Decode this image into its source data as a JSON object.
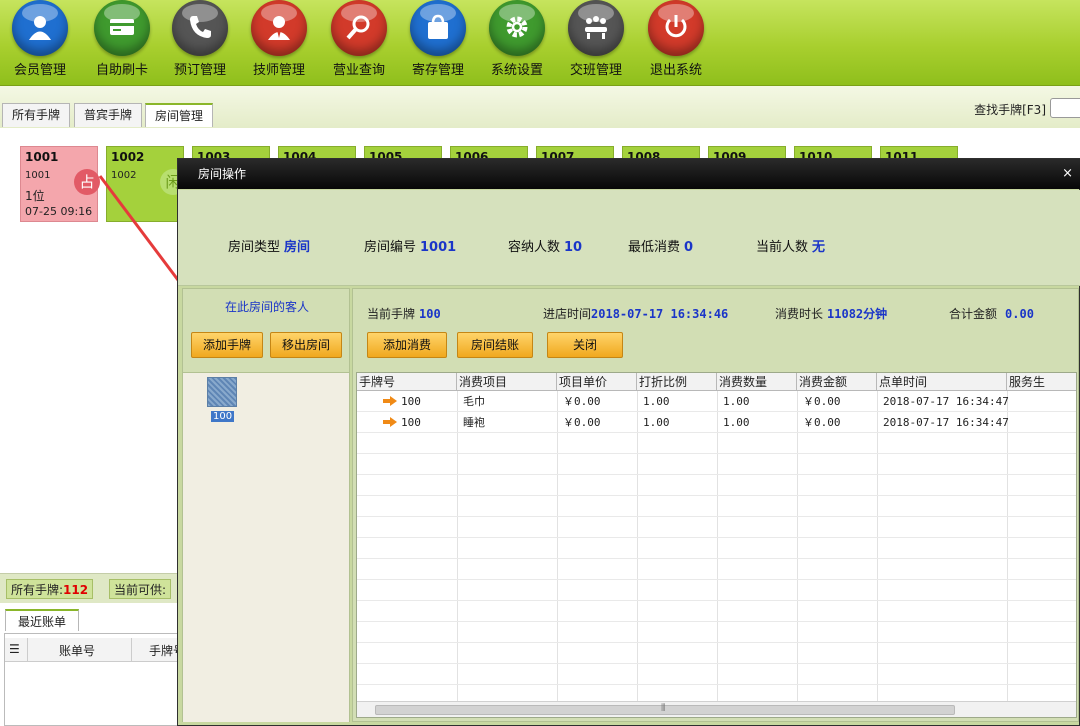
{
  "toolbar": {
    "items": [
      {
        "label": "会员管理",
        "icon": "member-icon",
        "color": "#1f6fd0"
      },
      {
        "label": "自助刷卡",
        "icon": "card-icon",
        "color": "#3f9a2e"
      },
      {
        "label": "预订管理",
        "icon": "phone-icon",
        "color": "#555555"
      },
      {
        "label": "技师管理",
        "icon": "technician-icon",
        "color": "#d23a2a"
      },
      {
        "label": "营业查询",
        "icon": "magnifier-icon",
        "color": "#d23a2a"
      },
      {
        "label": "寄存管理",
        "icon": "bag-icon",
        "color": "#1f6fd0"
      },
      {
        "label": "系统设置",
        "icon": "gear-icon",
        "color": "#3f9a2e"
      },
      {
        "label": "交班管理",
        "icon": "meeting-icon",
        "color": "#555555"
      },
      {
        "label": "退出系统",
        "icon": "power-icon",
        "color": "#d23a2a"
      }
    ]
  },
  "tabs": [
    {
      "label": "所有手牌"
    },
    {
      "label": "普宾手牌"
    },
    {
      "label": "房间管理",
      "active": true
    }
  ],
  "search": {
    "label": "查找手牌[F3]"
  },
  "rooms": [
    {
      "num": "1001",
      "sub": "1001",
      "guests": "1位",
      "time": "07-25 09:16",
      "badge": "占",
      "occupied": true
    },
    {
      "num": "1002",
      "sub": "1002",
      "badge": "闲"
    },
    {
      "num": "1003"
    },
    {
      "num": "1004"
    },
    {
      "num": "1005"
    },
    {
      "num": "1006"
    },
    {
      "num": "1007"
    },
    {
      "num": "1008"
    },
    {
      "num": "1009"
    },
    {
      "num": "1010"
    },
    {
      "num": "1011"
    }
  ],
  "status": {
    "all_label": "所有手牌:",
    "all_value": "112",
    "avail_label": "当前可供:"
  },
  "recent": {
    "tab": "最近账单",
    "headers": [
      "账单号",
      "手牌号"
    ]
  },
  "dialog": {
    "title": "房间操作",
    "close": "×",
    "info": {
      "type_label": "房间类型",
      "type_value": "房间",
      "num_label": "房间编号",
      "num_value": "1001",
      "capacity_label": "容纳人数",
      "capacity_value": "10",
      "min_label": "最低消费",
      "min_value": "0",
      "current_label": "当前人数",
      "current_value": "无"
    },
    "left": {
      "title": "在此房间的客人",
      "add_btn": "添加手牌",
      "remove_btn": "移出房间",
      "guest_label": "100"
    },
    "right": {
      "card_label": "当前手牌",
      "card_value": "100",
      "enter_label": "进店时间",
      "enter_value": "2018-07-17 16:34:46",
      "duration_label": "消费时长",
      "duration_value": "11082分钟",
      "total_label": "合计金额",
      "total_value": "0.00",
      "add_consume_btn": "添加消费",
      "checkout_btn": "房间结账",
      "close_btn": "关闭"
    },
    "grid": {
      "headers": [
        "手牌号",
        "消费项目",
        "项目单价",
        "打折比例",
        "消费数量",
        "消费金额",
        "点单时间",
        "服务生"
      ],
      "rows": [
        [
          "100",
          "毛巾",
          "￥0.00",
          "1.00",
          "1.00",
          "￥0.00",
          "2018-07-17 16:34:47",
          ""
        ],
        [
          "100",
          "睡袍",
          "￥0.00",
          "1.00",
          "1.00",
          "￥0.00",
          "2018-07-17 16:34:47",
          ""
        ]
      ],
      "scroll_grip": "⦀"
    }
  }
}
